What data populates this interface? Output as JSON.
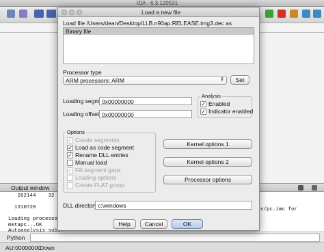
{
  "ida": {
    "title": "IDA - 6.3.120531",
    "output_title": "Output window",
    "output_lines": [
      "   262144    32 R",
      "",
      "  1310720",
      "",
      "Loading processor",
      "metapc...OK",
      "Autoanalysis subsy"
    ],
    "output_right_text": "ocs/pc.imc for",
    "python_label": "Python",
    "status_address": "AU:00000000",
    "status_state": "Down"
  },
  "dialog": {
    "title": "Load a new file",
    "load_file_text": "Load file /Users/dean/Desktop/LLB.n90ap.RELEASE.img3.dec as",
    "file_types": [
      "Binary file"
    ],
    "processor_type_label": "Processor type",
    "processor_value": "ARM processors: ARM",
    "set_button": "Set",
    "loading_segment_label": "Loading segment",
    "loading_segment_value": "0x00000000",
    "loading_offset_label": "Loading offset",
    "loading_offset_value": "0x00000000",
    "analysis": {
      "title": "Analysis",
      "enabled": "Enabled",
      "indicator": "Indicator enabled"
    },
    "options": {
      "title": "Options",
      "create_segments": "Create segments",
      "load_as_code": "Load as code segment",
      "rename_dll": "Rename DLL entries",
      "manual_load": "Manual load",
      "fill_gaps": "Fill segment gaps",
      "loading_options": "Loading options",
      "create_flat": "Create FLAT group"
    },
    "kernel_options_1": "Kernel options 1",
    "kernel_options_2": "Kernel options 2",
    "processor_options": "Processor options",
    "dll_directory_label": "DLL directory",
    "dll_directory_value": "c:\\windows",
    "help_button": "Help",
    "cancel_button": "Cancel",
    "ok_button": "OK"
  },
  "colors": {
    "selected_item_bg": "#c9c9c9",
    "dialog_bg": "#ececec"
  }
}
